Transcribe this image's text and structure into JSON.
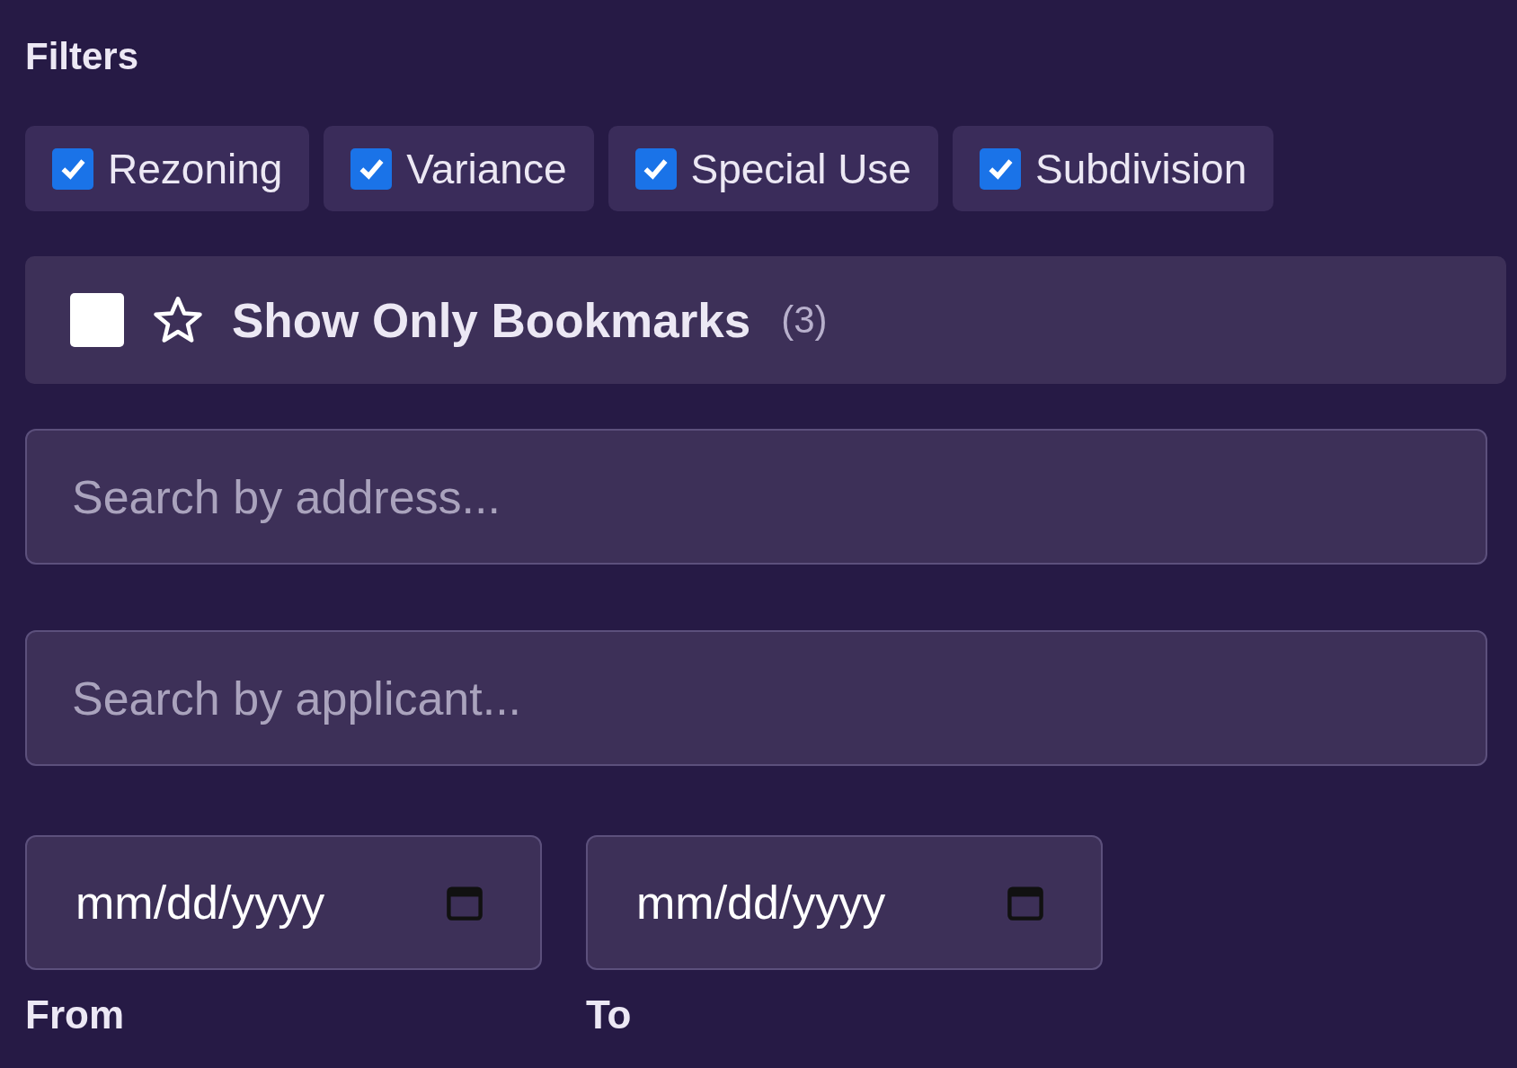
{
  "filters_title": "Filters",
  "types": [
    {
      "label": "Rezoning",
      "checked": true
    },
    {
      "label": "Variance",
      "checked": true
    },
    {
      "label": "Special Use",
      "checked": true
    },
    {
      "label": "Subdivision",
      "checked": true
    }
  ],
  "bookmarks": {
    "label": "Show Only Bookmarks",
    "count": "(3)",
    "checked": false
  },
  "search_fields": [
    {
      "placeholder": "Search by address..."
    },
    {
      "placeholder": "Search by applicant..."
    }
  ],
  "date_range": [
    {
      "placeholder": "mm/dd/yyyy",
      "label": "From"
    },
    {
      "placeholder": "mm/dd/yyyy",
      "label": "To"
    }
  ]
}
